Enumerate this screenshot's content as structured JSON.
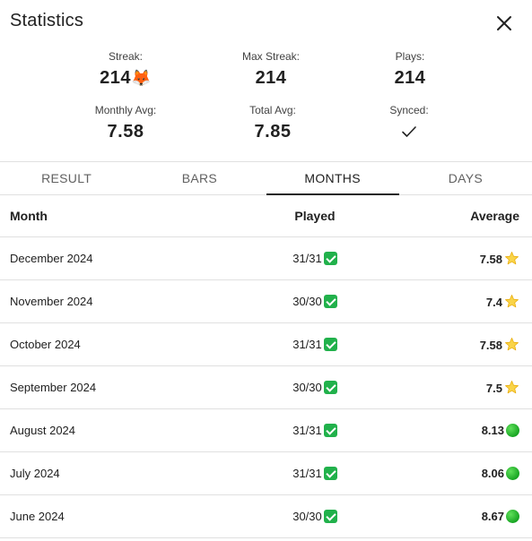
{
  "dialog": {
    "title": "Statistics",
    "close_icon": "close-icon"
  },
  "stats": {
    "streak_label": "Streak:",
    "streak_value": "214",
    "streak_emoji": "🦊",
    "max_streak_label": "Max Streak:",
    "max_streak_value": "214",
    "plays_label": "Plays:",
    "plays_value": "214",
    "monthly_avg_label": "Monthly Avg:",
    "monthly_avg_value": "7.58",
    "total_avg_label": "Total Avg:",
    "total_avg_value": "7.85",
    "synced_label": "Synced:",
    "synced_icon": "checkmark-icon"
  },
  "tabs": [
    {
      "label": "RESULT",
      "active": false
    },
    {
      "label": "BARS",
      "active": false
    },
    {
      "label": "MONTHS",
      "active": true
    },
    {
      "label": "DAYS",
      "active": false
    }
  ],
  "table": {
    "headers": {
      "month": "Month",
      "played": "Played",
      "average": "Average"
    },
    "rows": [
      {
        "month": "December 2024",
        "played": "31/31",
        "average": "7.58",
        "badge": "star"
      },
      {
        "month": "November 2024",
        "played": "30/30",
        "average": "7.4",
        "badge": "star"
      },
      {
        "month": "October 2024",
        "played": "31/31",
        "average": "7.58",
        "badge": "star"
      },
      {
        "month": "September 2024",
        "played": "30/30",
        "average": "7.5",
        "badge": "star"
      },
      {
        "month": "August 2024",
        "played": "31/31",
        "average": "8.13",
        "badge": "green-circle"
      },
      {
        "month": "July 2024",
        "played": "31/31",
        "average": "8.06",
        "badge": "green-circle"
      },
      {
        "month": "June 2024",
        "played": "30/30",
        "average": "8.67",
        "badge": "green-circle"
      }
    ]
  },
  "colors": {
    "check_green": "#21b14b",
    "star_yellow": "#f9d449",
    "dot_green": "#18a523"
  }
}
